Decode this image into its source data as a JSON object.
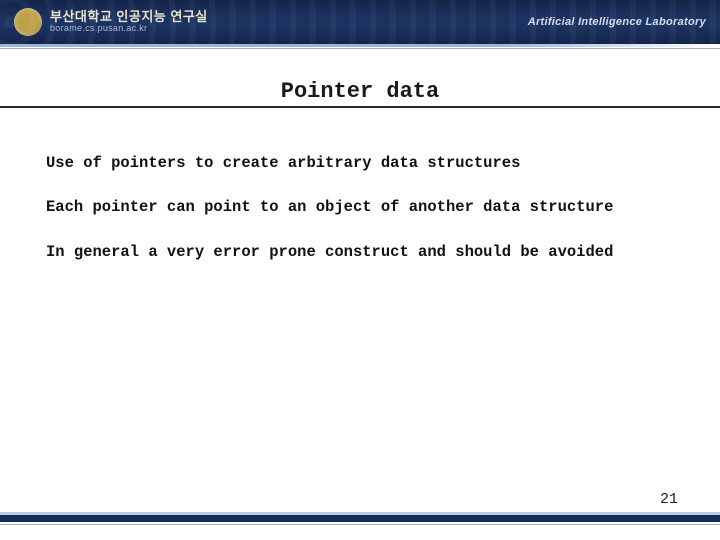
{
  "header": {
    "org_title": "부산대학교 인공지능 연구실",
    "url": "borame.cs.pusan.ac.kr",
    "lab_name": "Artificial Intelligence Laboratory"
  },
  "title": "Pointer data",
  "bullets": [
    "Use of pointers to create arbitrary data structures",
    "Each pointer can point to an object of another data structure",
    "In general a very error prone construct and should be avoided"
  ],
  "page_number": "21"
}
